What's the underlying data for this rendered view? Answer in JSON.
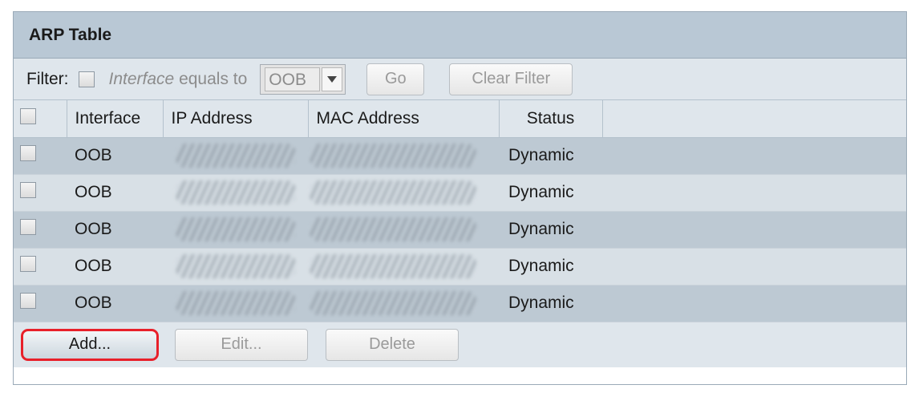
{
  "panel": {
    "title": "ARP Table"
  },
  "filter": {
    "label": "Filter:",
    "field_name": "Interface",
    "operator": "equals to",
    "selected_value": "OOB",
    "go_label": "Go",
    "clear_label": "Clear Filter"
  },
  "table": {
    "columns": [
      "Interface",
      "IP Address",
      "MAC Address",
      "Status"
    ],
    "rows": [
      {
        "interface": "OOB",
        "status": "Dynamic"
      },
      {
        "interface": "OOB",
        "status": "Dynamic"
      },
      {
        "interface": "OOB",
        "status": "Dynamic"
      },
      {
        "interface": "OOB",
        "status": "Dynamic"
      },
      {
        "interface": "OOB",
        "status": "Dynamic"
      }
    ]
  },
  "actions": {
    "add_label": "Add...",
    "edit_label": "Edit...",
    "delete_label": "Delete"
  },
  "colors": {
    "title_bar": "#b9c8d5",
    "row_dark": "#bdc9d3",
    "row_light": "#d8e0e6",
    "highlight_border": "#e8202a"
  },
  "icons": {
    "select_arrow": "triangle-down-icon"
  }
}
